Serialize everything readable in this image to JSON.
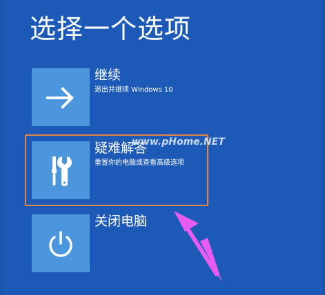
{
  "page": {
    "title": "选择一个选项"
  },
  "options": [
    {
      "id": "continue",
      "title": "继续",
      "description": "退出并继续 Windows 10",
      "icon": "arrow-right-icon"
    },
    {
      "id": "troubleshoot",
      "title": "疑难解答",
      "description": "重置你的电脑或查看高级选项",
      "icon": "tools-icon"
    },
    {
      "id": "shutdown",
      "title": "关闭电脑",
      "description": "",
      "icon": "power-icon"
    }
  ],
  "watermark": {
    "text": "www.pHome.NET"
  },
  "colors": {
    "background": "#1d5ab8",
    "tile": "#4b96dc",
    "text": "#ffffff",
    "highlight_border": "#e2864a",
    "annotation_arrow": "#e75cf0"
  }
}
